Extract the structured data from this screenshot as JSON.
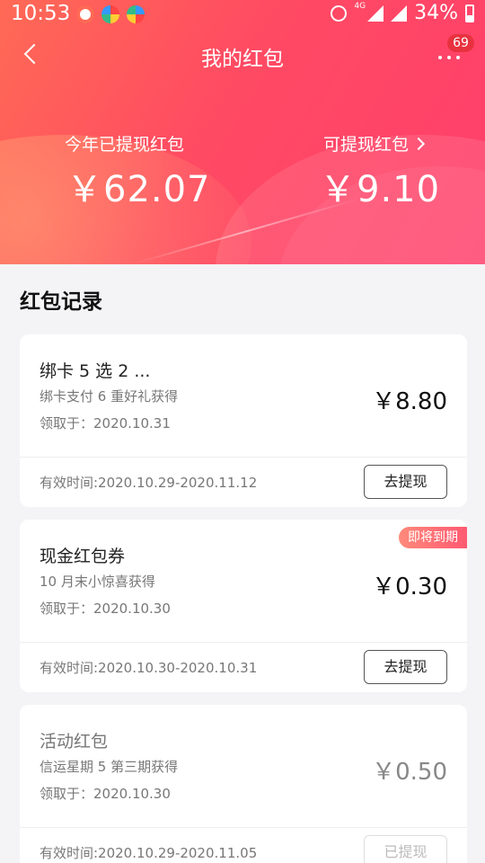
{
  "status_bar": {
    "time": "10:53",
    "network": "4G",
    "battery": "34%",
    "app_icons": [
      "app-notification-icon",
      "app-color-icon-1",
      "app-color-icon-2"
    ]
  },
  "nav": {
    "title": "我的红包",
    "badge": "69"
  },
  "summary": {
    "withdrawn_label": "今年已提现红包",
    "withdrawn_amount": "￥62.07",
    "available_label": "可提现红包",
    "available_amount": "￥9.10"
  },
  "records_title": "红包记录",
  "records": [
    {
      "name": "绑卡 5 选 2 ...",
      "desc": "绑卡支付 6 重好礼获得",
      "date": "领取于：2020.10.31",
      "amount": "￥8.80",
      "valid": "有效时间:2020.10.29-2020.11.12",
      "button": "去提现"
    },
    {
      "name": "现金红包券",
      "desc": "10 月末小惊喜获得",
      "date": "领取于：2020.10.30",
      "amount": "￥0.30",
      "valid": "有效时间:2020.10.30-2020.10.31",
      "button": "去提现",
      "tag": "即将到期"
    },
    {
      "name": "活动红包",
      "desc": "信运星期 5 第三期获得",
      "date": "领取于：2020.10.30",
      "amount": "￥0.50",
      "valid": "有效时间:2020.10.29-2020.11.05",
      "button": "已提现"
    }
  ],
  "colors": {
    "header_start": "#ff6a55",
    "header_end": "#ff3f6c",
    "badge": "#e8323f",
    "tag": "#ff5a72"
  }
}
